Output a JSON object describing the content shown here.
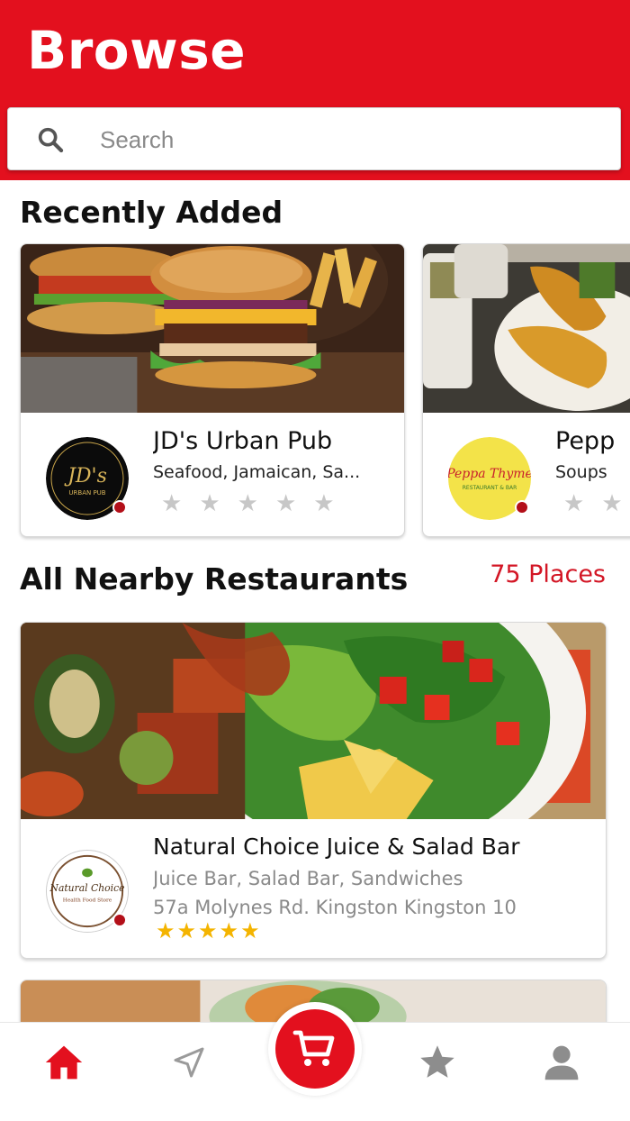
{
  "header": {
    "title": "Browse",
    "color": "#e3101e"
  },
  "search": {
    "placeholder": "Search"
  },
  "recent": {
    "title": "Recently Added",
    "cards": [
      {
        "name": "JD's Urban Pub",
        "cuisine": "Seafood, Jamaican, Sa...",
        "rating": 0,
        "max_rating": 5,
        "logo_text": "JD's",
        "logo_sub": "URBAN PUB"
      },
      {
        "name": "Pepp",
        "cuisine": "Soups",
        "rating": 0,
        "max_rating": 5,
        "logo_text": "Peppa Thyme",
        "logo_sub": "RESTAURANT & BAR"
      }
    ]
  },
  "nearby": {
    "title": "All Nearby Restaurants",
    "count_label": "75 Places",
    "cards": [
      {
        "name": "Natural Choice Juice & Salad Bar",
        "cuisine": "Juice Bar, Salad Bar, Sandwiches",
        "address": "57a Molynes Rd. Kingston Kingston 10",
        "rating": 5,
        "max_rating": 5,
        "logo_text": "Natural Choice",
        "logo_sub": "Health Food Store"
      }
    ]
  },
  "tabbar": {
    "items": [
      {
        "name": "home",
        "icon": "home-icon",
        "active": true
      },
      {
        "name": "nearby",
        "icon": "navigation-arrow-icon",
        "active": false
      },
      {
        "name": "cart",
        "icon": "cart-icon",
        "active": false
      },
      {
        "name": "favorites",
        "icon": "star-icon",
        "active": false
      },
      {
        "name": "profile",
        "icon": "person-icon",
        "active": false
      }
    ]
  },
  "colors": {
    "accent": "#e3101e",
    "count": "#d31625",
    "star_full": "#f4b400",
    "star_empty": "#c7c7c7",
    "inactive_icon": "#9a9a9a"
  }
}
